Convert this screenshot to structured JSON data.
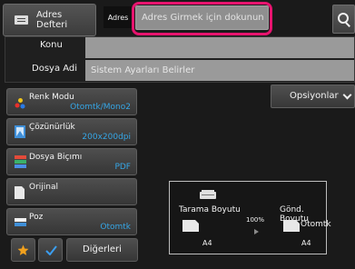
{
  "header": {
    "address_book_label": "Adres Defteri",
    "address_book_line1": "Adres",
    "address_book_line2": "Defteri",
    "address_tab_label": "Adres",
    "address_placeholder": "Adres Girmek için dokunun"
  },
  "fields": {
    "subject_label": "Konu",
    "subject_value": "",
    "filename_label": "Dosya Adi",
    "filename_value": "Sistem Ayarları Belirler"
  },
  "options": [
    {
      "name": "Renk Modu",
      "value": "Otomtk/Mono2",
      "icon": "color-mode-icon"
    },
    {
      "name": "Çözünürlük",
      "value": "200x200dpi",
      "icon": "resolution-icon"
    },
    {
      "name": "Dosya Biçımı",
      "value": "PDF",
      "icon": "file-format-icon"
    },
    {
      "name": "Orijinal",
      "value": "",
      "icon": "original-icon"
    },
    {
      "name": "Poz",
      "value": "Otomtk",
      "icon": "exposure-icon"
    }
  ],
  "options_button": "Opsiyonlar",
  "size_panel": {
    "scan_size_label": "Tarama Boyutu",
    "scan_size_value": "A4",
    "ratio": "100%",
    "send_size_label": "Gönd. Boyutu",
    "send_size_mode": "Otomtk",
    "send_size_value": "A4"
  },
  "bottom": {
    "others_label": "Diğerleri"
  },
  "colors": {
    "highlight": "#e6136e",
    "value_blue": "#36a6e6",
    "star": "#f2a11d",
    "check": "#3b9ef0"
  }
}
